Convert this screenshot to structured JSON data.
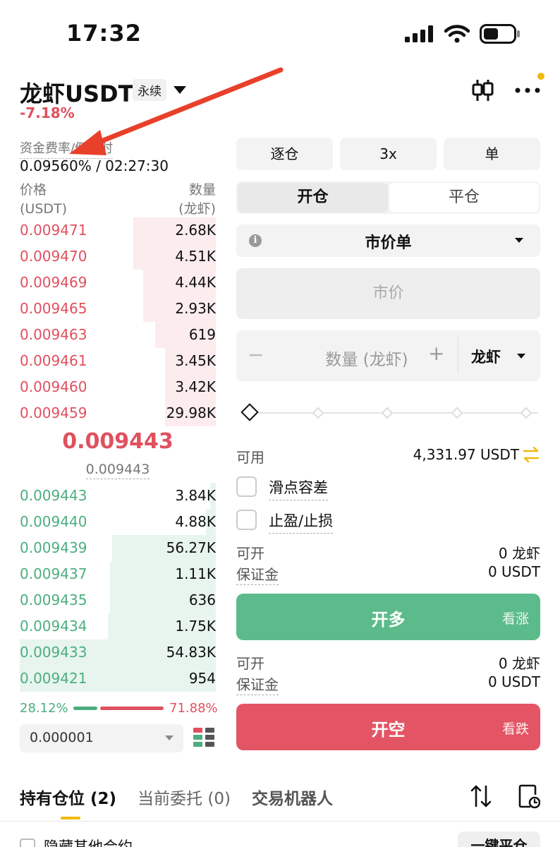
{
  "status_bar": {
    "time": "17:32"
  },
  "header": {
    "pair": "龙虾USDT",
    "contract_type": "永续",
    "change": "-7.18%",
    "icons": [
      "candlestick-chart-icon",
      "more-icon"
    ]
  },
  "funding": {
    "label": "资金费率/倒计时",
    "value": "0.09560% / 02:27:30"
  },
  "orderbook": {
    "price_header": [
      "价格",
      "(USDT)"
    ],
    "qty_header": [
      "数量",
      "(龙虾)"
    ],
    "asks": [
      {
        "price": "0.009471",
        "qty": "2.68K",
        "depth": 0.42
      },
      {
        "price": "0.009470",
        "qty": "4.51K",
        "depth": 0.42
      },
      {
        "price": "0.009469",
        "qty": "4.44K",
        "depth": 0.37
      },
      {
        "price": "0.009465",
        "qty": "2.93K",
        "depth": 0.37
      },
      {
        "price": "0.009463",
        "qty": "619",
        "depth": 0.31
      },
      {
        "price": "0.009461",
        "qty": "3.45K",
        "depth": 0.26
      },
      {
        "price": "0.009460",
        "qty": "3.42K",
        "depth": 0.26
      },
      {
        "price": "0.009459",
        "qty": "29.98K",
        "depth": 0.26
      }
    ],
    "last_price": "0.009443",
    "mark_price": "0.009443",
    "bids": [
      {
        "price": "0.009443",
        "qty": "3.84K",
        "depth": 0.03
      },
      {
        "price": "0.009440",
        "qty": "4.88K",
        "depth": 0.05
      },
      {
        "price": "0.009439",
        "qty": "56.27K",
        "depth": 0.53
      },
      {
        "price": "0.009437",
        "qty": "1.11K",
        "depth": 0.54
      },
      {
        "price": "0.009435",
        "qty": "636",
        "depth": 0.54
      },
      {
        "price": "0.009434",
        "qty": "1.75K",
        "depth": 0.55
      },
      {
        "price": "0.009433",
        "qty": "54.83K",
        "depth": 1.0
      },
      {
        "price": "0.009421",
        "qty": "954",
        "depth": 1.0
      }
    ],
    "buy_ratio": "28.12%",
    "sell_ratio": "71.88%",
    "precision": "0.000001"
  },
  "trade": {
    "margin_mode": "逐仓",
    "leverage": "3x",
    "position_mode": "单",
    "tab_open": "开仓",
    "tab_close": "平仓",
    "order_type": "市价单",
    "price_placeholder": "市价",
    "qty_placeholder": "数量 (龙虾)",
    "qty_unit": "龙虾",
    "available_label": "可用",
    "available_value": "4,331.97 USDT",
    "slippage_label": "滑点容差",
    "tpsl_label": "止盈/止损",
    "long": {
      "can_open_label": "可开",
      "can_open_value": "0 龙虾",
      "margin_label": "保证金",
      "margin_value": "0 USDT",
      "button": "开多",
      "sub": "看涨"
    },
    "short": {
      "can_open_label": "可开",
      "can_open_value": "0 龙虾",
      "margin_label": "保证金",
      "margin_value": "0 USDT",
      "button": "开空",
      "sub": "看跌"
    }
  },
  "bottom": {
    "tab_positions": "持有仓位 (2)",
    "tab_orders": "当前委托 (0)",
    "tab_bot": "交易机器人",
    "hide_label": "隐藏其他合约",
    "close_all": "一键平仓"
  },
  "colors": {
    "ask": "#e0505e",
    "bid": "#4cae7e",
    "accent": "#f0b90b",
    "annotation": "#e8402a"
  }
}
